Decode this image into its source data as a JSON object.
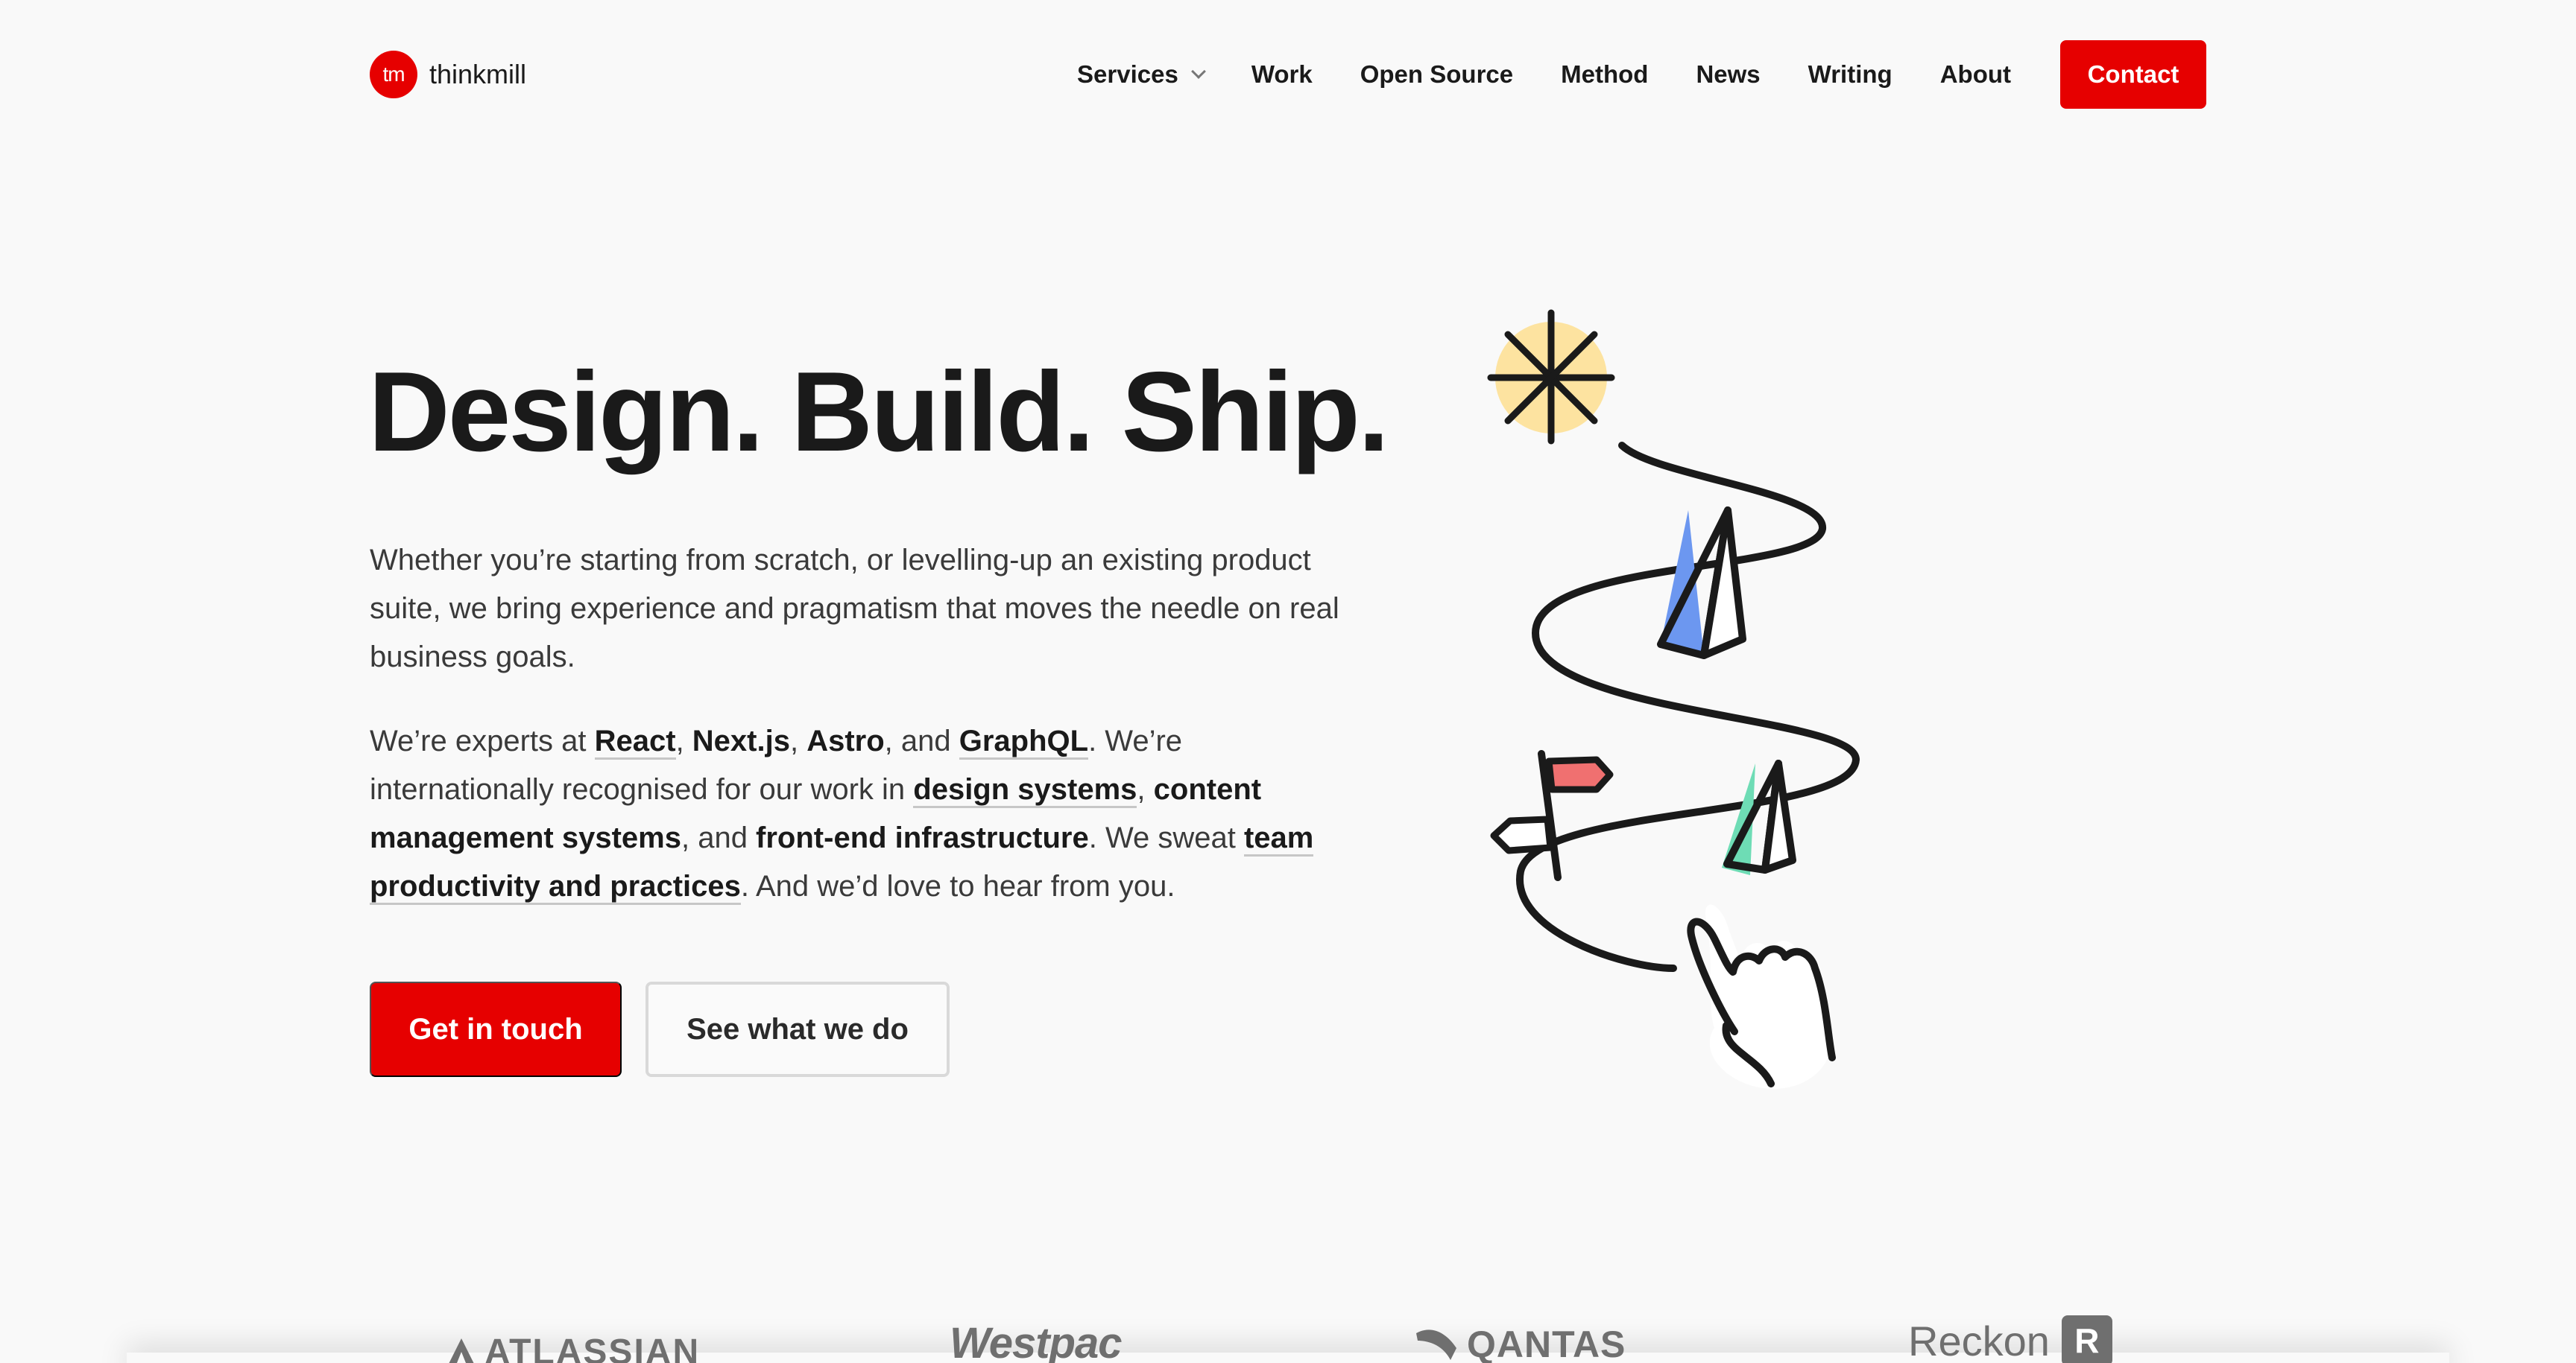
{
  "header": {
    "logo_mark": "tm",
    "logo_name": "thinkmill",
    "nav": [
      "Services",
      "Work",
      "Open Source",
      "Method",
      "News",
      "Writing",
      "About"
    ],
    "contact_label": "Contact"
  },
  "hero": {
    "title": "Design. Build. Ship.",
    "intro": "Whether you’re starting from scratch, or levelling-up an existing product suite, we bring experience and pragmatism that moves the needle on real business goals.",
    "experts": {
      "t1": "We’re experts at ",
      "react": "React",
      "sep1": ", ",
      "nextjs": "Next.js",
      "sep2": ", ",
      "astro": "Astro",
      "t2": ", and ",
      "graphql": "GraphQL",
      "t3": ". We’re internationally recognised for our work in ",
      "design_systems": "design systems",
      "sep3": ", ",
      "cms": "content management systems",
      "t4": ", and ",
      "frontend_infra": "front-end infrastructure",
      "t5": ". We sweat ",
      "team_productivity": "team productivity and practices",
      "t6": ". And we’d love to hear from you."
    },
    "cta_primary": "Get in touch",
    "cta_secondary": "See what we do"
  },
  "logos": {
    "atlassian": "ATLASSIAN",
    "westpac": "Westpac",
    "qantas": "QANTAS",
    "reckon": "Reckon",
    "reckon_mark": "R"
  },
  "colors": {
    "brand_red": "#e60000",
    "background": "#f9f9f9",
    "sun_yellow": "#fde3a0",
    "tent_blue": "#6c97f0",
    "tent_green": "#6edcb5",
    "flag_red": "#f07070"
  }
}
